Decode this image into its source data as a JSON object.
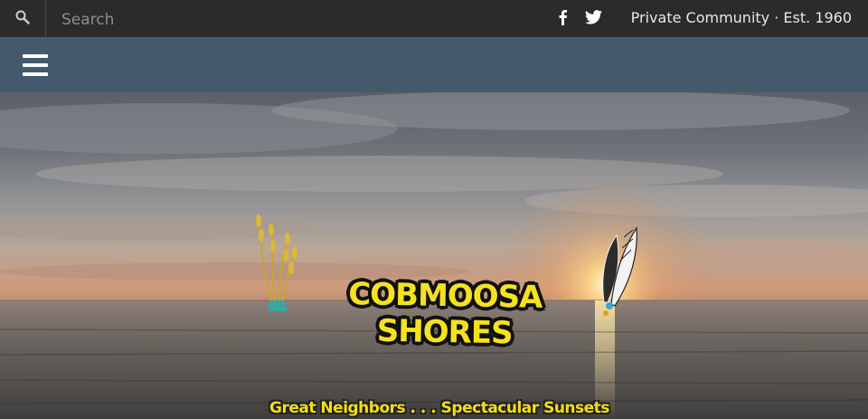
{
  "topbar": {
    "search_placeholder": "Search",
    "search_icon": "search-icon",
    "social": [
      "facebook-icon",
      "twitter-icon"
    ],
    "tagline": "Private Community · Est. 1960"
  },
  "nav": {
    "menu_icon": "hamburger-menu-icon"
  },
  "hero": {
    "image": "sunset-over-lake",
    "logo_title": "COBMOOSA SHORES",
    "logo_subtitle": "Great Neighbors . . . Spectacular Sunsets",
    "colors": {
      "logo_text": "#f5e21f",
      "logo_outline": "#111111",
      "nav_bar": "#445a6c",
      "top_bar": "#2b2b2b"
    }
  }
}
